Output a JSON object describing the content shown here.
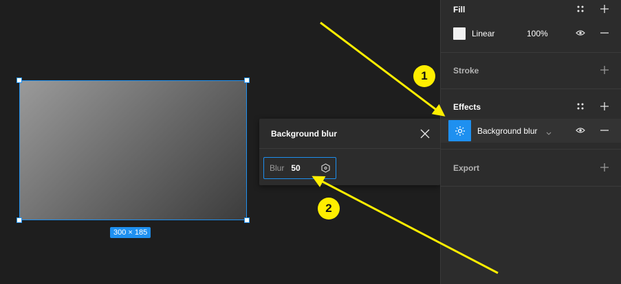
{
  "canvas": {
    "size_label": "300 × 185"
  },
  "popover": {
    "title": "Background blur",
    "blur_label": "Blur",
    "blur_value": "50"
  },
  "panel": {
    "fill": {
      "title": "Fill",
      "type": "Linear",
      "opacity": "100%",
      "swatch_color": "#f2f2f2"
    },
    "stroke": {
      "title": "Stroke"
    },
    "effects": {
      "title": "Effects",
      "item_label": "Background blur"
    },
    "export": {
      "title": "Export"
    }
  },
  "annotations": {
    "step1": "1",
    "step2": "2",
    "arrow_color": "#ffee00"
  },
  "colors": {
    "accent": "#1e90f0",
    "panel_bg": "#2c2c2c",
    "canvas_bg": "#1e1e1e"
  }
}
